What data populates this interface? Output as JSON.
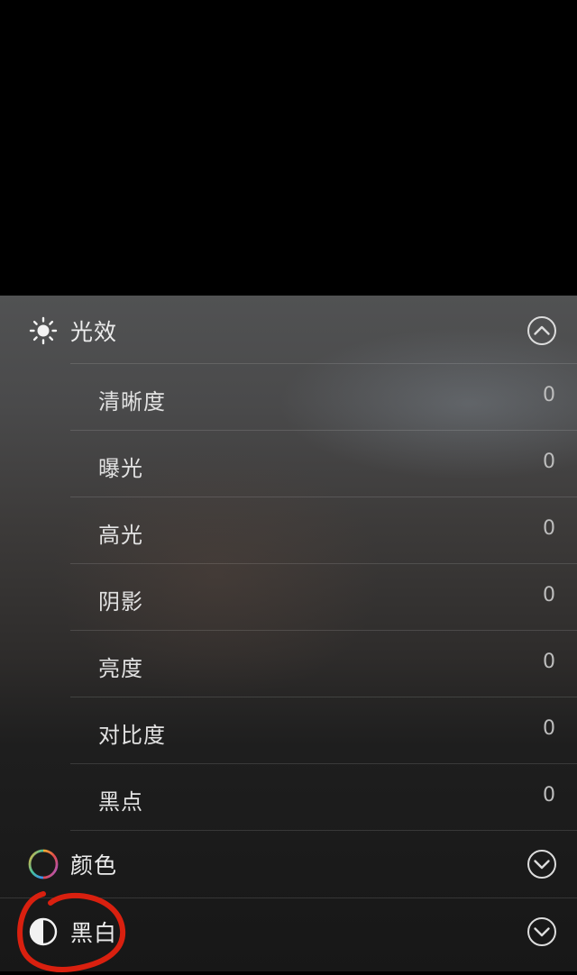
{
  "sections": [
    {
      "icon": "sun-icon",
      "title": "光效",
      "expanded": true,
      "items": [
        {
          "label": "清晰度",
          "value": "0"
        },
        {
          "label": "曝光",
          "value": "0"
        },
        {
          "label": "高光",
          "value": "0"
        },
        {
          "label": "阴影",
          "value": "0"
        },
        {
          "label": "亮度",
          "value": "0"
        },
        {
          "label": "对比度",
          "value": "0"
        },
        {
          "label": "黑点",
          "value": "0"
        }
      ]
    },
    {
      "icon": "color-wheel-icon",
      "title": "颜色",
      "expanded": false
    },
    {
      "icon": "half-circle-icon",
      "title": "黑白",
      "expanded": false
    }
  ],
  "colors": {
    "annotation": "#d9200f",
    "text": "#e6e6e6",
    "value": "#bdbdbd"
  }
}
